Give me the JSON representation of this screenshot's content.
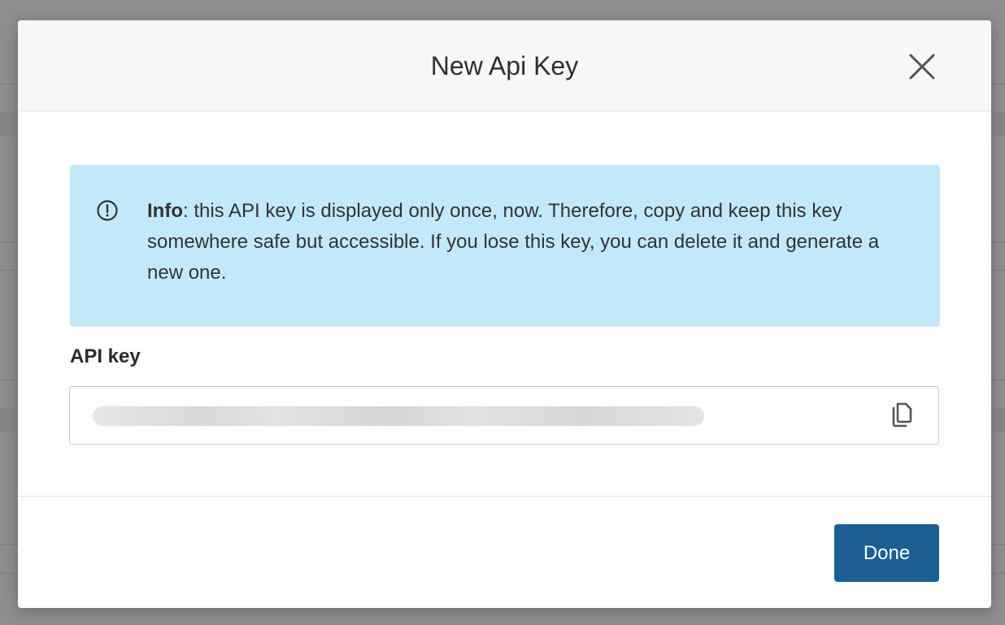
{
  "modal": {
    "title": "New Api Key",
    "close_icon": "close-icon",
    "info": {
      "icon": "exclamation-circle-icon",
      "lead": "Info",
      "text": ": this API key is displayed only once, now. Therefore, copy and keep this key somewhere safe but accessible. If you lose this key, you can delete it and generate a new one.",
      "background": "#c2e9f9"
    },
    "api_key": {
      "label": "API key",
      "value": "",
      "copy_icon": "copy-icon"
    },
    "done_label": "Done",
    "accent": "#1a5e94"
  }
}
